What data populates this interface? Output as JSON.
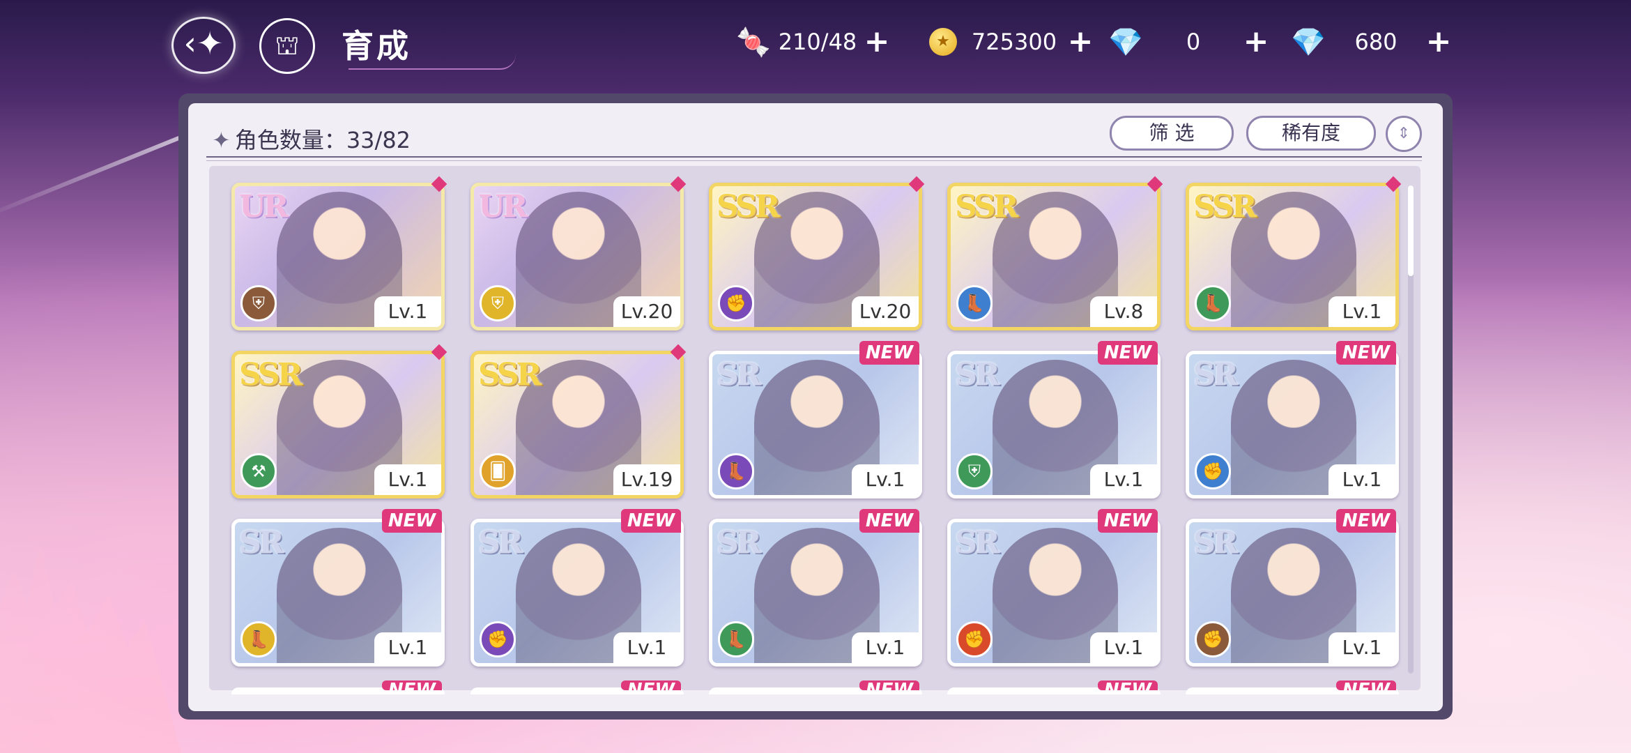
{
  "header": {
    "title": "育成",
    "back_icon": "back-arrow-icon",
    "home_icon": "castle-icon"
  },
  "currencies": [
    {
      "name": "candy",
      "icon": "🍬",
      "value": "210/48"
    },
    {
      "name": "coin",
      "icon": "★",
      "value": "725300"
    },
    {
      "name": "pink-gem",
      "icon": "💎",
      "value": "0"
    },
    {
      "name": "blue-gem",
      "icon": "💎",
      "value": "680"
    }
  ],
  "toolbar": {
    "count_label": "角色数量：33/82",
    "filter_label": "筛 选",
    "sort_label": "稀有度",
    "sort_toggle_icon": "⇕"
  },
  "cards": [
    {
      "rarity": "UR",
      "level": "Lv.1",
      "role": "shield",
      "role_color": "#8a5a3a",
      "badge": "diamond"
    },
    {
      "rarity": "UR",
      "level": "Lv.20",
      "role": "shield",
      "role_color": "#e0b52a",
      "badge": "diamond"
    },
    {
      "rarity": "SSR",
      "level": "Lv.20",
      "role": "fist",
      "role_color": "#7a4ab8",
      "badge": "diamond"
    },
    {
      "rarity": "SSR",
      "level": "Lv.8",
      "role": "boot",
      "role_color": "#3f7fcf",
      "badge": "diamond"
    },
    {
      "rarity": "SSR",
      "level": "Lv.1",
      "role": "boot",
      "role_color": "#3f9a5a",
      "badge": "diamond"
    },
    {
      "rarity": "SSR",
      "level": "Lv.1",
      "role": "hammer",
      "role_color": "#3f9a5a",
      "badge": "diamond"
    },
    {
      "rarity": "SSR",
      "level": "Lv.19",
      "role": "cards",
      "role_color": "#e0a22a",
      "badge": "diamond"
    },
    {
      "rarity": "SR",
      "level": "Lv.1",
      "role": "boot",
      "role_color": "#7a4ab8",
      "badge": "NEW"
    },
    {
      "rarity": "SR",
      "level": "Lv.1",
      "role": "shield",
      "role_color": "#3f9a5a",
      "badge": "NEW"
    },
    {
      "rarity": "SR",
      "level": "Lv.1",
      "role": "fist",
      "role_color": "#3f7fcf",
      "badge": "NEW"
    },
    {
      "rarity": "SR",
      "level": "Lv.1",
      "role": "boot",
      "role_color": "#e0b52a",
      "badge": "NEW"
    },
    {
      "rarity": "SR",
      "level": "Lv.1",
      "role": "fist",
      "role_color": "#7a4ab8",
      "badge": "NEW"
    },
    {
      "rarity": "SR",
      "level": "Lv.1",
      "role": "boot",
      "role_color": "#3f9a5a",
      "badge": "NEW"
    },
    {
      "rarity": "SR",
      "level": "Lv.1",
      "role": "fist",
      "role_color": "#d94a2a",
      "badge": "NEW"
    },
    {
      "rarity": "SR",
      "level": "Lv.1",
      "role": "fist",
      "role_color": "#8a5a3a",
      "badge": "NEW"
    }
  ],
  "partial_row_badges": [
    "NEW",
    "NEW",
    "NEW",
    "NEW",
    "NEW"
  ],
  "colors": {
    "accent_pink": "#e0397b",
    "panel_border": "#524869"
  }
}
